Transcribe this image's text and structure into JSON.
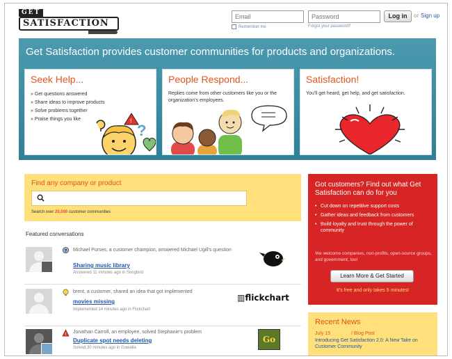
{
  "header": {
    "logo_top": "GET",
    "logo_main": "SATISFACTION",
    "email_placeholder": "Email",
    "password_placeholder": "Password",
    "login_label": "Log in",
    "or_text": "or",
    "signup_label": "Sign up",
    "remember_label": "Remember me",
    "forgot_label": "Forgot your password?"
  },
  "hero": {
    "title": "Get Satisfaction provides customer communities for products and organizations.",
    "cards": [
      {
        "title": "Seek Help...",
        "items": [
          "Get questions answered",
          "Share ideas to improve products",
          "Solve problems together",
          "Praise things you like"
        ]
      },
      {
        "title": "People Respond...",
        "text": "Replies come from other customers like you or the organization's employees."
      },
      {
        "title": "Satisfaction!",
        "text": "You'll get heard, get help, and get satisfaction."
      }
    ]
  },
  "search": {
    "title": "Find any company or product",
    "sub_prefix": "Search over",
    "count": "20,000",
    "sub_suffix": "customer communities"
  },
  "featured": {
    "title": "Featured conversations",
    "items": [
      {
        "type_icon": "question-icon",
        "text": "Michael Purses, a customer champion, answered Michael Ugill's question",
        "link": "Sharing music library",
        "meta": "Answered 11 minutes ago in Songbird",
        "logo": "songbird-logo"
      },
      {
        "type_icon": "idea-icon",
        "text": "brent, a customer, shared an idea that got implemented",
        "link": "movies missing",
        "meta": "Implemented 14 minutes ago in Flickchart",
        "logo": "flickchart"
      },
      {
        "type_icon": "problem-icon",
        "text": "Jonathan Carroll, an employee, solved Stephanie's problem",
        "link": "Duplicate spot needs deleting",
        "meta": "Solved 30 minutes ago in Gowalla",
        "logo": "Go"
      }
    ]
  },
  "promo": {
    "title": "Got customers? Find out what Get Satisfaction can do for you",
    "items": [
      "Cut down on repetitive support costs",
      "Gather ideas and feedback from customers",
      "Build loyalty and trust through the power of community"
    ],
    "welcome": "We welcome companies, non-profits, open-source groups, and government, too!",
    "button": "Learn More & Get Started",
    "free": "It's free and only takes 5 minutes!"
  },
  "news": {
    "title": "Recent News",
    "date": "July 15",
    "category": "/ Blog Post",
    "headline": "Introducing Get Satisfaction 2.0: A New Take on Customer Community"
  },
  "colors": {
    "hero": "#3e8fa6",
    "accent": "#e0561f",
    "promo": "#d72424",
    "yellow": "#ffe07a",
    "link": "#2456a6"
  }
}
